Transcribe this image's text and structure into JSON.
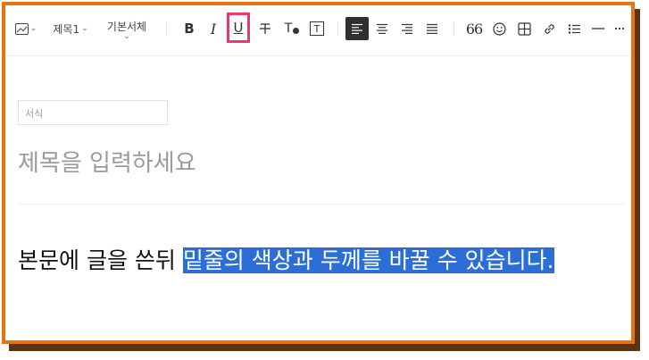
{
  "toolbar": {
    "image_icon": "image-icon",
    "heading_select": "제목1",
    "font_select": "기본서체",
    "bold_label": "B",
    "italic_label": "I",
    "underline_label": "U",
    "strikethrough_label": "T",
    "text_color_label": "T",
    "text_bg_label": "T",
    "quote_label": "66",
    "highlight_color": "#ea3a6b",
    "active_align_color": "#2f2f2f"
  },
  "editor": {
    "format_placeholder": "서식",
    "title_placeholder": "제목을 입력하세요",
    "body_plain": "본문에 글을 쓴뒤 ",
    "body_selected": "밑줄의 색상과 두께를 바꿀 수 있습니다.",
    "selection_color": "#2b6fd6"
  },
  "frame": {
    "border_color": "#e8720c"
  }
}
